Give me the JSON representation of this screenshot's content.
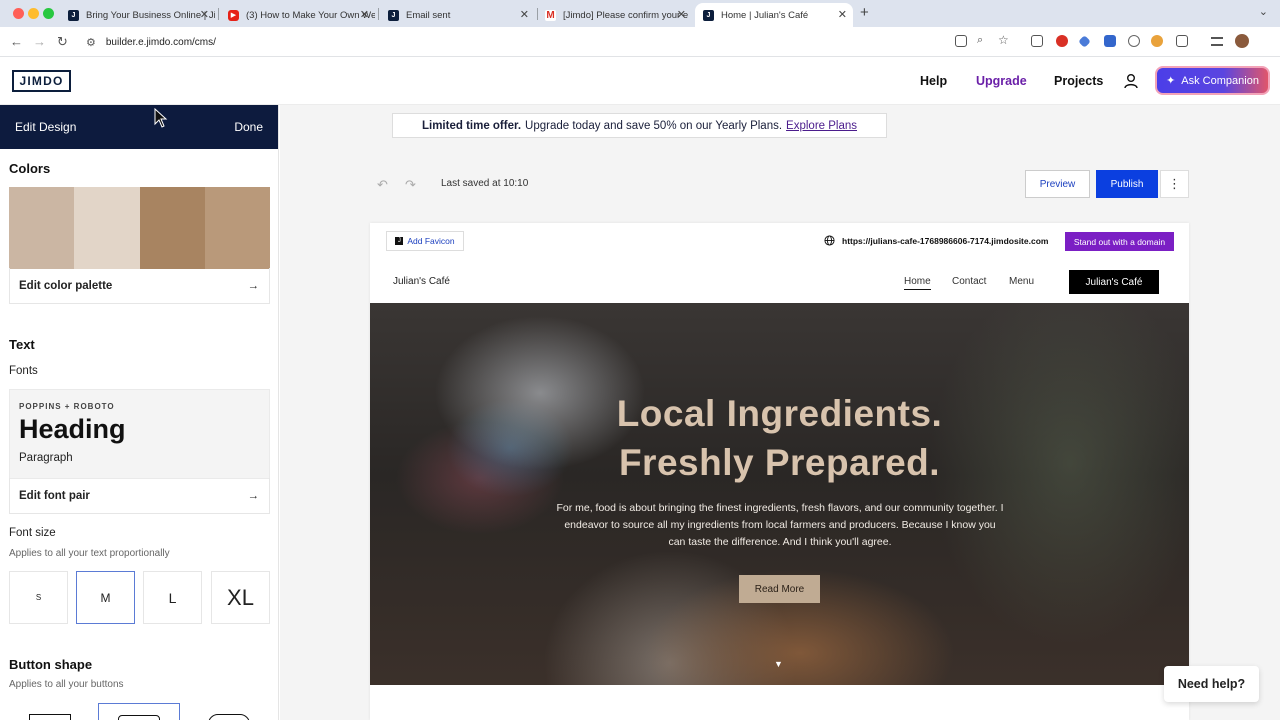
{
  "browser": {
    "tabs": [
      {
        "title": "Bring Your Business Online | Ji",
        "favicon": "jimdo-favicon",
        "color": "#0c1e3c"
      },
      {
        "title": "(3) How to Make Your Own We",
        "favicon": "youtube-favicon",
        "color": "#e62117"
      },
      {
        "title": "Email sent",
        "favicon": "jimdo-favicon",
        "color": "#0c1e3c"
      },
      {
        "title": "[Jimdo] Please confirm your e",
        "favicon": "gmail-favicon",
        "color": "#d93025"
      },
      {
        "title": "Home | Julian's Café",
        "favicon": "jimdo-favicon",
        "color": "#0c1e3c"
      }
    ],
    "active_tab": 4,
    "url": "builder.e.jimdo.com/cms/"
  },
  "header": {
    "logo": "JIMDO",
    "help": "Help",
    "upgrade": "Upgrade",
    "projects": "Projects",
    "companion": "Ask Companion"
  },
  "sidebar": {
    "title": "Edit Design",
    "done": "Done",
    "colors_title": "Colors",
    "palette": [
      "#cbb6a3",
      "#e2d5c8",
      "#a88461",
      "#b9997a"
    ],
    "edit_palette": "Edit color palette",
    "text_title": "Text",
    "fonts_label": "Fonts",
    "font_combo": "POPPINS + ROBOTO",
    "font_heading": "Heading",
    "font_paragraph": "Paragraph",
    "edit_font_pair": "Edit font pair",
    "font_size_label": "Font size",
    "font_size_hint": "Applies to all your text proportionally",
    "font_sizes": [
      "S",
      "M",
      "L",
      "XL"
    ],
    "font_size_selected": "M",
    "button_shape_label": "Button shape",
    "button_shape_hint": "Applies to all your buttons"
  },
  "editor": {
    "offer_bold": "Limited time offer.",
    "offer_text": "Upgrade today and save 50% on our Yearly Plans.",
    "offer_link": "Explore Plans",
    "last_saved": "Last saved at 10:10",
    "preview": "Preview",
    "publish": "Publish",
    "more": "⋮"
  },
  "site": {
    "add_favicon": "Add Favicon",
    "domain_url": "https://julians-cafe-1768986606-7174.jimdosite.com",
    "domain_cta": "Stand out with a domain",
    "brand": "Julian's Café",
    "nav": [
      "Home",
      "Contact",
      "Menu"
    ],
    "nav_cta": "Julian's Café",
    "hero_line1": "Local Ingredients.",
    "hero_line2": "Freshly Prepared.",
    "hero_text": "For me, food is about bringing the finest ingredients, fresh flavors, and our community together. I endeavor to source all my ingredients from local farmers and producers. Because I know you can taste the difference. And I think you'll agree.",
    "hero_button": "Read More"
  },
  "help_widget": "Need help?"
}
